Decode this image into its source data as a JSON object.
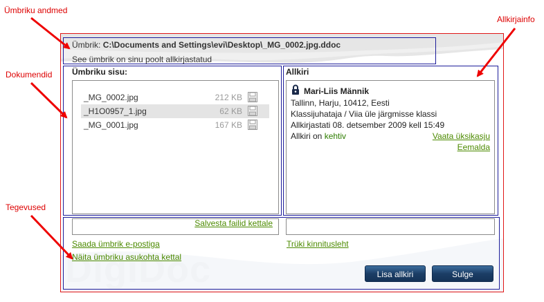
{
  "annotations": {
    "envelope_data": "Ümbriku andmed",
    "documents": "Dokumendid",
    "actions": "Tegevused",
    "signature_info": "Allkirjainfo"
  },
  "header": {
    "envelope_label": "Ümbrik:",
    "envelope_path": "C:\\Documents and Settings\\evi\\Desktop\\_MG_0002.jpg.ddoc",
    "signed_by_you": "See ümbrik on sinu poolt allkirjastatud"
  },
  "watermark": "DigiDoc",
  "contents": {
    "title": "Ümbriku sisu:",
    "files": [
      {
        "name": "_MG_0002.jpg",
        "size": "212 KB",
        "save_icon": "floppy-disk-icon"
      },
      {
        "name": "_H1O0957_1.jpg",
        "size": "62 KB",
        "save_icon": "floppy-disk-icon"
      },
      {
        "name": "_MG_0001.jpg",
        "size": "167 KB",
        "save_icon": "floppy-disk-icon"
      }
    ],
    "save_files_link": "Salvesta failid kettale"
  },
  "signature": {
    "title": "Allkiri",
    "icon": "lock-person-icon",
    "name": "Mari-Liis Männik",
    "location": "Tallinn, Harju, 10412, Eesti",
    "role": "Klassijuhataja / Viia üle järgmisse klassi",
    "signed_at": "Allkirjastati 08. detsember 2009 kell 15:49",
    "validity_prefix": "Allkiri on",
    "validity_status": "kehtiv",
    "view_details_link": "Vaata üksikasju",
    "remove_link": "Eemalda",
    "print_link": "Trüki kinnitusleht"
  },
  "actions": {
    "email_link": "Saada ümbrik e-postiga",
    "show_location_link": "Näita ümbriku asukohta kettal",
    "add_signature_button": "Lisa allkiri",
    "close_button": "Sulge"
  },
  "colors": {
    "annotation_red": "#dd0000",
    "frame_blue": "#1b1b99",
    "link_green": "#4c8a00",
    "button_navy": "#1b3e66"
  }
}
